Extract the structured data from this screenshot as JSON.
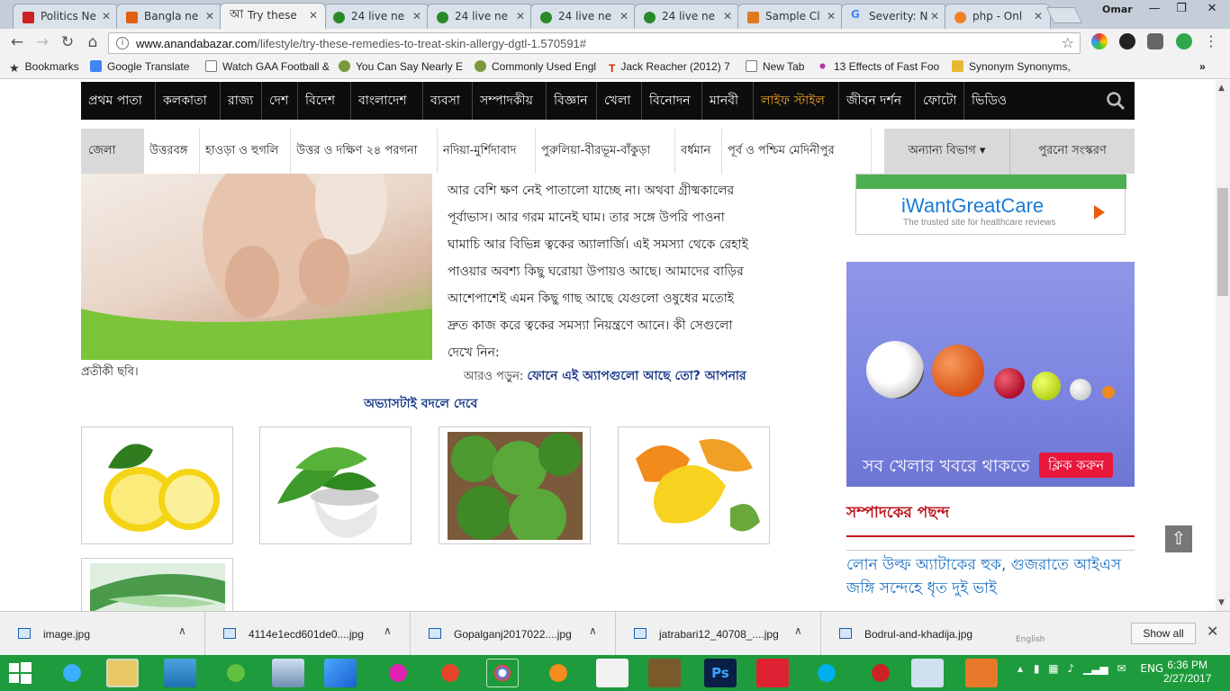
{
  "browser": {
    "tabs": [
      {
        "title": "Politics Ne",
        "color": "#cc2222"
      },
      {
        "title": "Bangla ne",
        "color": "#e06010"
      },
      {
        "title": "Try these",
        "color": "#222222",
        "active": true,
        "glyph": "আ"
      },
      {
        "title": "24 live ne",
        "color": "#2a8a2a"
      },
      {
        "title": "24 live ne",
        "color": "#2a8a2a"
      },
      {
        "title": "24 live ne",
        "color": "#2a8a2a"
      },
      {
        "title": "24 live ne",
        "color": "#2a8a2a"
      },
      {
        "title": "Sample Cl",
        "color": "#e07a20"
      },
      {
        "title": "Severity: N",
        "color": "#4285f4",
        "glyph": "G"
      },
      {
        "title": "php - Onl",
        "color": "#f48024"
      }
    ],
    "user": "Omar",
    "url_host": "www.anandabazar.com",
    "url_path": "/lifestyle/try-these-remedies-to-treat-skin-allergy-dgtl-1.570591#",
    "bookmarks": [
      {
        "label": "Bookmarks",
        "icon": "star-icon"
      },
      {
        "label": "Google Translate",
        "icon": "translate-icon"
      },
      {
        "label": "Watch GAA Football &",
        "icon": "page-icon"
      },
      {
        "label": "You Can Say Nearly E",
        "icon": "leaf-icon"
      },
      {
        "label": "Commonly Used Engl",
        "icon": "leaf-icon"
      },
      {
        "label": "Jack Reacher (2012) 7",
        "icon": "t-icon"
      },
      {
        "label": "New Tab",
        "icon": "page-icon"
      },
      {
        "label": "13 Effects of Fast Foo",
        "icon": "dots-icon"
      },
      {
        "label": "Synonym Synonyms,",
        "icon": "folder-icon"
      }
    ]
  },
  "site": {
    "main_nav": [
      "প্রথম পাতা",
      "কলকাতা",
      "রাজ্য",
      "দেশ",
      "বিদেশ",
      "বাংলাদেশ",
      "ব্যবসা",
      "সম্পাদকীয়",
      "বিজ্ঞান",
      "খেলা",
      "বিনোদন",
      "মানবী",
      "লাইফ স্টাইল",
      "জীবন দর্শন",
      "ফোটো",
      "ভিডিও"
    ],
    "main_nav_highlight": "লাইফ স্টাইল",
    "sub_nav_label": "জেলা",
    "sub_nav": [
      "উত্তরবঙ্গ",
      "হাওড়া ও হুগলি",
      "উত্তর ও দক্ষিণ ২৪ পরগনা",
      "নদিয়া-মুর্শিদাবাদ",
      "পুরুলিয়া-বীরভূম-বাঁকুড়া",
      "বর্ধমান",
      "পূর্ব ও পশ্চিম মেদিনীপুর"
    ],
    "other_sections": "অন্যান্য বিভাগ ▾",
    "old_edition": "পুরনো সংস্করণ"
  },
  "article": {
    "lines": [
      "আর বেশি ক্ষণ নেই পাতালো যাচ্ছে না। অথবা গ্রীষ্মকালের",
      "পূর্বাভাস। আর গরম মানেই ঘাম। তার সঙ্গে উপরি পাওনা",
      "ঘামাচি আর বিভিন্ন ত্বকের অ্যালার্জি। এই সমস্যা থেকে রেহাই",
      "পাওয়ার অবশ্য কিছু ঘরোয়া উপায়ও আছে। আমাদের বাড়ির",
      "আশেপাশেই এমন কিছু গাছ আছে যেগুলো ওষুধের মতোই",
      "দ্রুত কাজ করে ত্বকের সমস্যা নিয়ন্ত্রণে আনে। কী সেগুলো",
      "দেখে নিন:"
    ],
    "caption": "প্রতীকী ছবি।",
    "read_more_prefix": "আরও পড়ুন:",
    "read_more_link": "ফোনে এই অ্যাপগুলো আছে তো? আপনার",
    "read_more_link_2": "অভ্যাসটাই বদলে দেবে",
    "thumbnails": [
      "lemon",
      "tulsi-mortar",
      "mint",
      "orange-peel",
      "aloe-vera"
    ]
  },
  "sidebar": {
    "ad1_brand": "iWantGreatCare",
    "ad1_tagline": "The trusted site for healthcare reviews",
    "ad2_text": "সব খেলার খবরে থাকতে",
    "ad2_cta": "ক্লিক করুন",
    "editor_heading": "সম্পাদকের পছন্দ",
    "editor_link": "লোন উল্ফ অ্যাটাকের হুক, গুজরাতে আইএস জঙ্গি সন্দেহে ধৃত দুই ভাই"
  },
  "downloads": {
    "items": [
      "image.jpg",
      "4114e1ecd601de0....jpg",
      "Gopalganj2017022....jpg",
      "jatrabari12_40708_....jpg",
      "Bodrul-and-khadija.jpg"
    ],
    "show_all": "Show all"
  },
  "taskbar": {
    "language": "ENG",
    "time": "6:36 PM",
    "date": "2/27/2017",
    "ime_label": "English"
  }
}
